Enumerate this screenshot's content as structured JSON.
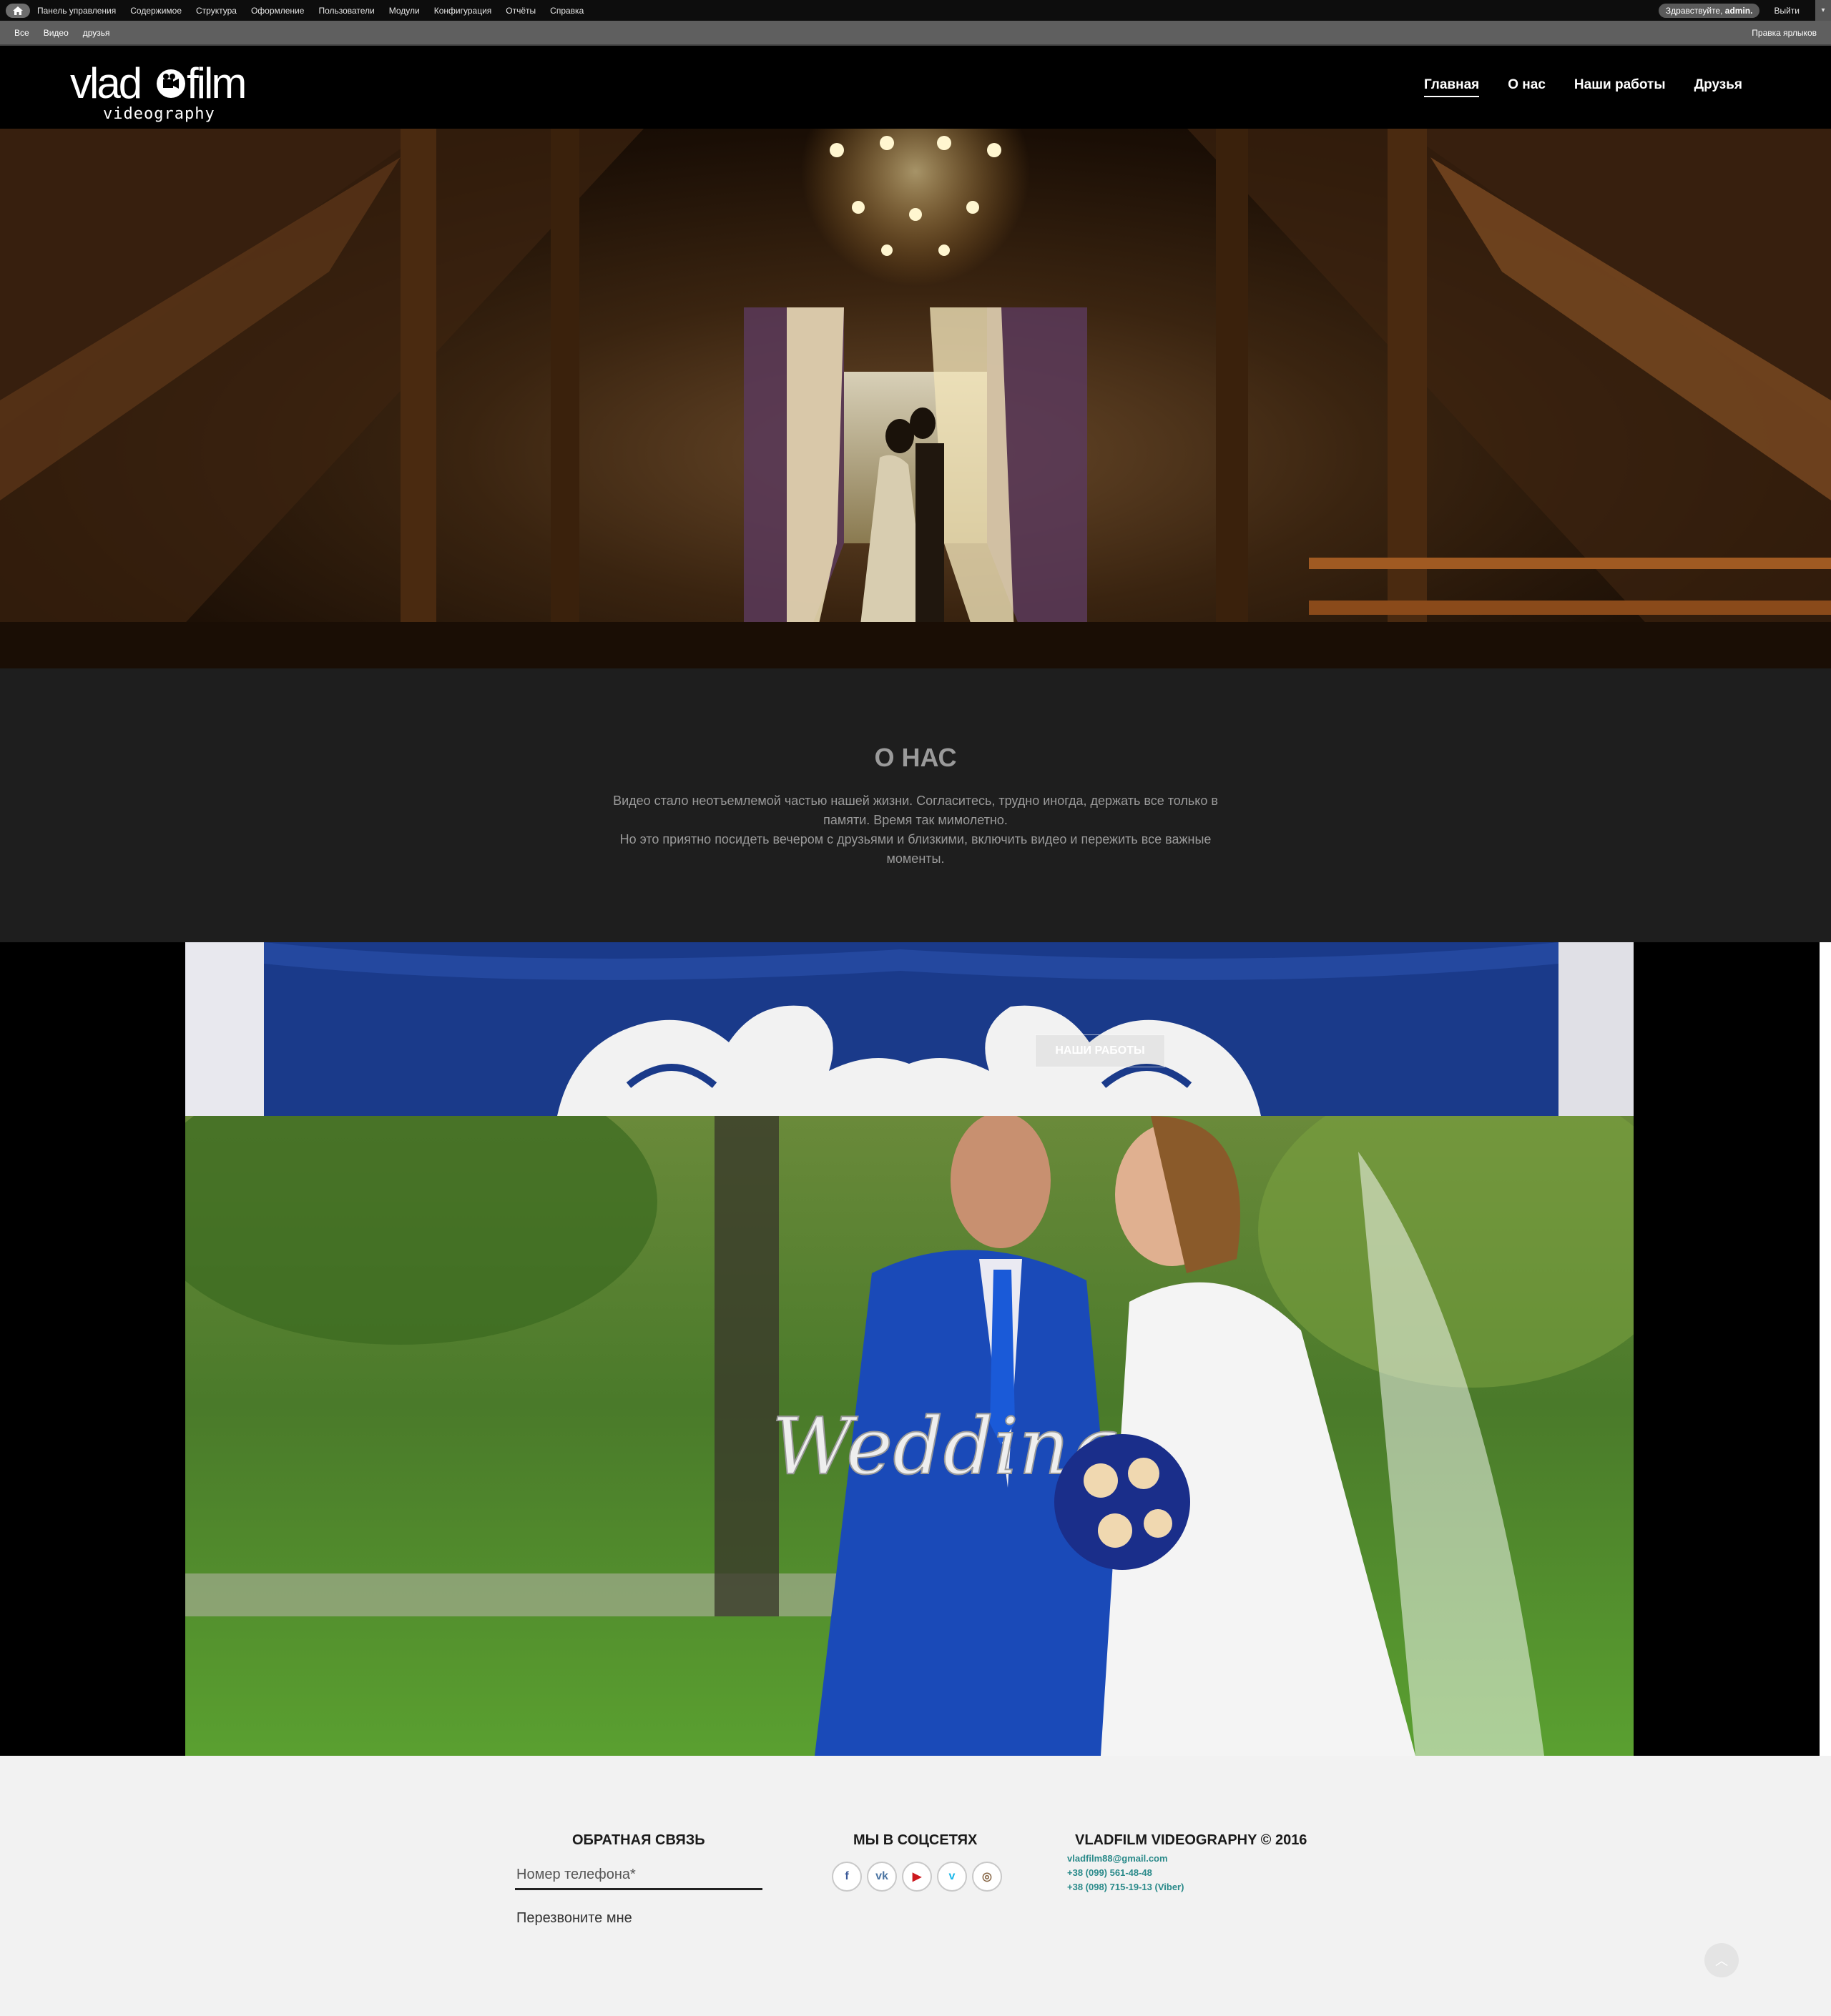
{
  "admin_toolbar": {
    "menu": [
      "Панель управления",
      "Содержимое",
      "Структура",
      "Оформление",
      "Пользователи",
      "Модули",
      "Конфигурация",
      "Отчёты",
      "Справка"
    ],
    "greeting_prefix": "Здравствуйте,",
    "greeting_user": "admin.",
    "logout": "Выйти",
    "dropdown_icon": "▾"
  },
  "shortcuts": {
    "items": [
      "Все",
      "Видео",
      "друзья"
    ],
    "edit_label": "Правка ярлыков"
  },
  "header": {
    "logo_main": "vlad film",
    "logo_sub": "videography",
    "nav": [
      "Главная",
      "О нас",
      "Наши работы",
      "Друзья"
    ],
    "active_nav": "Главная"
  },
  "hero": {
    "image": "wedding couple kissing by window in wooden hall"
  },
  "about": {
    "title": "О НАС",
    "paragraph1": "Видео стало неотъемлемой частью нашей жизни. Согласитесь, трудно иногда, держать все только в памяти. Время так мимолетно.",
    "paragraph2": "Но это приятно посидеть вечером с друзьями и близкими, включить видео и пережить все важные моменты."
  },
  "works": {
    "button_label": "НАШИ РАБОТЫ",
    "gear_icon": "⚙"
  },
  "footer": {
    "feedback_title": "ОБРАТНАЯ СВЯЗЬ",
    "phone_placeholder": "Номер телефона*",
    "callback_label": "Перезвоните мне",
    "social_title": "МЫ В СОЦСЕТЯХ",
    "socials": [
      {
        "name": "facebook-icon",
        "glyph": "f",
        "color": "#3b5998"
      },
      {
        "name": "vk-icon",
        "glyph": "vk",
        "color": "#4c75a3"
      },
      {
        "name": "youtube-icon",
        "glyph": "▶",
        "color": "#cc181e"
      },
      {
        "name": "vimeo-icon",
        "glyph": "v",
        "color": "#1ab7ea"
      },
      {
        "name": "instagram-icon",
        "glyph": "◎",
        "color": "#8a6a4a"
      }
    ],
    "company_title": "VLADFILM VIDEOGRAPHY © 2016",
    "email": "vladfilm88@gmail.com",
    "phone1": "+38 (099) 561-48-48",
    "phone2": "+38 (098) 715-19-13 (Viber)"
  }
}
